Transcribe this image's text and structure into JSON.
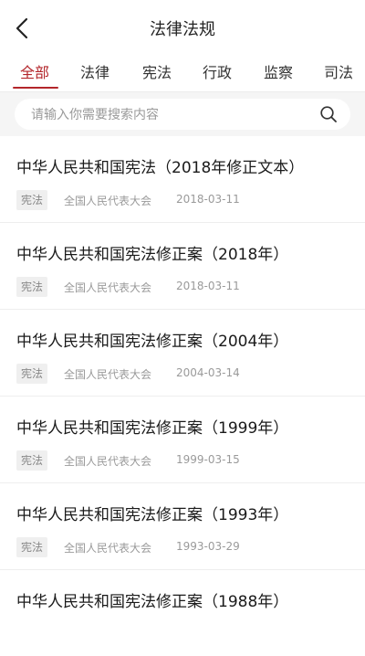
{
  "header": {
    "title": "法律法规",
    "back_icon": "chevron-left-icon"
  },
  "tabs": [
    {
      "label": "全部",
      "active": true
    },
    {
      "label": "法律",
      "active": false
    },
    {
      "label": "宪法",
      "active": false
    },
    {
      "label": "行政",
      "active": false
    },
    {
      "label": "监察",
      "active": false
    },
    {
      "label": "司法",
      "active": false
    }
  ],
  "search": {
    "placeholder": "请输入你需要搜索内容",
    "value": "",
    "icon": "search-icon"
  },
  "colors": {
    "accent": "#b3262b",
    "badge_bg": "#efefef",
    "meta": "#9a9a9a"
  },
  "items": [
    {
      "title": "中华人民共和国宪法（2018年修正文本）",
      "tag": "宪法",
      "source": "全国人民代表大会",
      "date": "2018-03-11"
    },
    {
      "title": "中华人民共和国宪法修正案（2018年）",
      "tag": "宪法",
      "source": "全国人民代表大会",
      "date": "2018-03-11"
    },
    {
      "title": "中华人民共和国宪法修正案（2004年）",
      "tag": "宪法",
      "source": "全国人民代表大会",
      "date": "2004-03-14"
    },
    {
      "title": "中华人民共和国宪法修正案（1999年）",
      "tag": "宪法",
      "source": "全国人民代表大会",
      "date": "1999-03-15"
    },
    {
      "title": "中华人民共和国宪法修正案（1993年）",
      "tag": "宪法",
      "source": "全国人民代表大会",
      "date": "1993-03-29"
    },
    {
      "title": "中华人民共和国宪法修正案（1988年）",
      "tag": "",
      "source": "",
      "date": ""
    }
  ]
}
